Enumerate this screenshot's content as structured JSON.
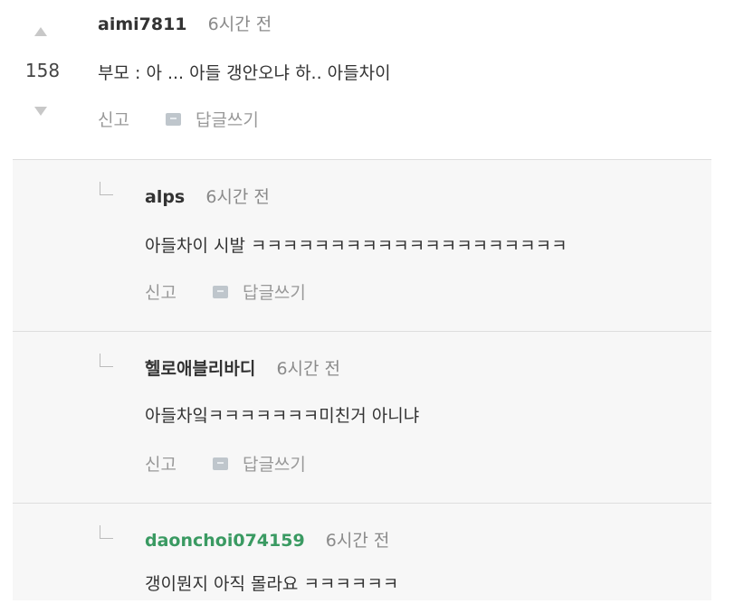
{
  "main_comment": {
    "author": "aimi7811",
    "time": "6시간 전",
    "votes": "158",
    "text": "부모 : 아 ... 아들 갱안오냐 하.. 아들차이",
    "report_label": "신고",
    "reply_label": "답글쓰기"
  },
  "replies": [
    {
      "author": "alps",
      "time": "6시간 전",
      "text": "아들차이 시발 ㅋㅋㅋㅋㅋㅋㅋㅋㅋㅋㅋㅋㅋㅋㅋㅋㅋㅋㅋㅋ",
      "report_label": "신고",
      "reply_label": "답글쓰기"
    },
    {
      "author": "헬로애블리바디",
      "time": "6시간 전",
      "text": "아들차잌ㅋㅋㅋㅋㅋㅋㅋ미친거 아니냐",
      "report_label": "신고",
      "reply_label": "답글쓰기"
    },
    {
      "author": "daonchoi074159",
      "time": "6시간 전",
      "text": "갱이뭔지 아직 몰라요 ㅋㅋㅋㅋㅋㅋ"
    }
  ],
  "colors": {
    "author_highlight": "#3a9a62",
    "reply_background": "#f7f7f7"
  }
}
